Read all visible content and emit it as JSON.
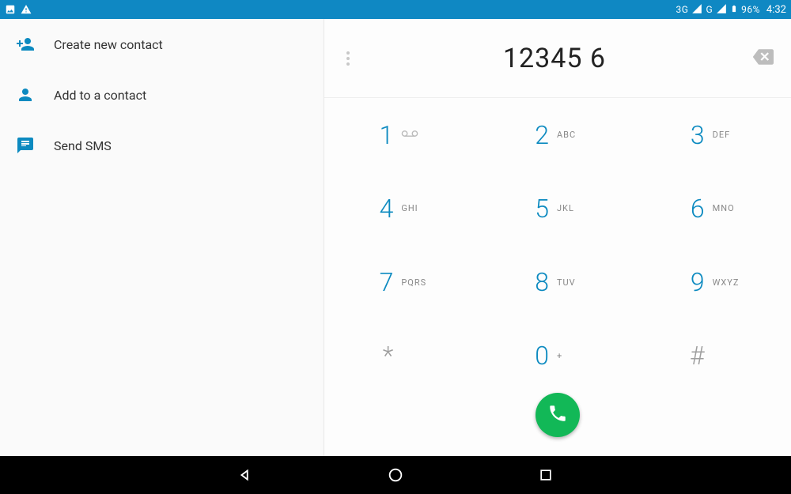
{
  "status": {
    "network1": "3G",
    "network2": "G",
    "battery_pct": "96%",
    "time": "4:32"
  },
  "left_panel": {
    "items": [
      {
        "label": "Create new contact"
      },
      {
        "label": "Add to a contact"
      },
      {
        "label": "Send SMS"
      }
    ]
  },
  "dialer": {
    "entered_number": "12345 6",
    "keys": [
      {
        "digit": "1",
        "letters": ""
      },
      {
        "digit": "2",
        "letters": "ABC"
      },
      {
        "digit": "3",
        "letters": "DEF"
      },
      {
        "digit": "4",
        "letters": "GHI"
      },
      {
        "digit": "5",
        "letters": "JKL"
      },
      {
        "digit": "6",
        "letters": "MNO"
      },
      {
        "digit": "7",
        "letters": "PQRS"
      },
      {
        "digit": "8",
        "letters": "TUV"
      },
      {
        "digit": "9",
        "letters": "WXYZ"
      },
      {
        "digit": "*",
        "letters": ""
      },
      {
        "digit": "0",
        "letters": "+"
      },
      {
        "digit": "#",
        "letters": ""
      }
    ]
  },
  "colors": {
    "accent": "#0c8ac0",
    "call_green": "#12b857",
    "statusbar": "#0f88c3"
  }
}
